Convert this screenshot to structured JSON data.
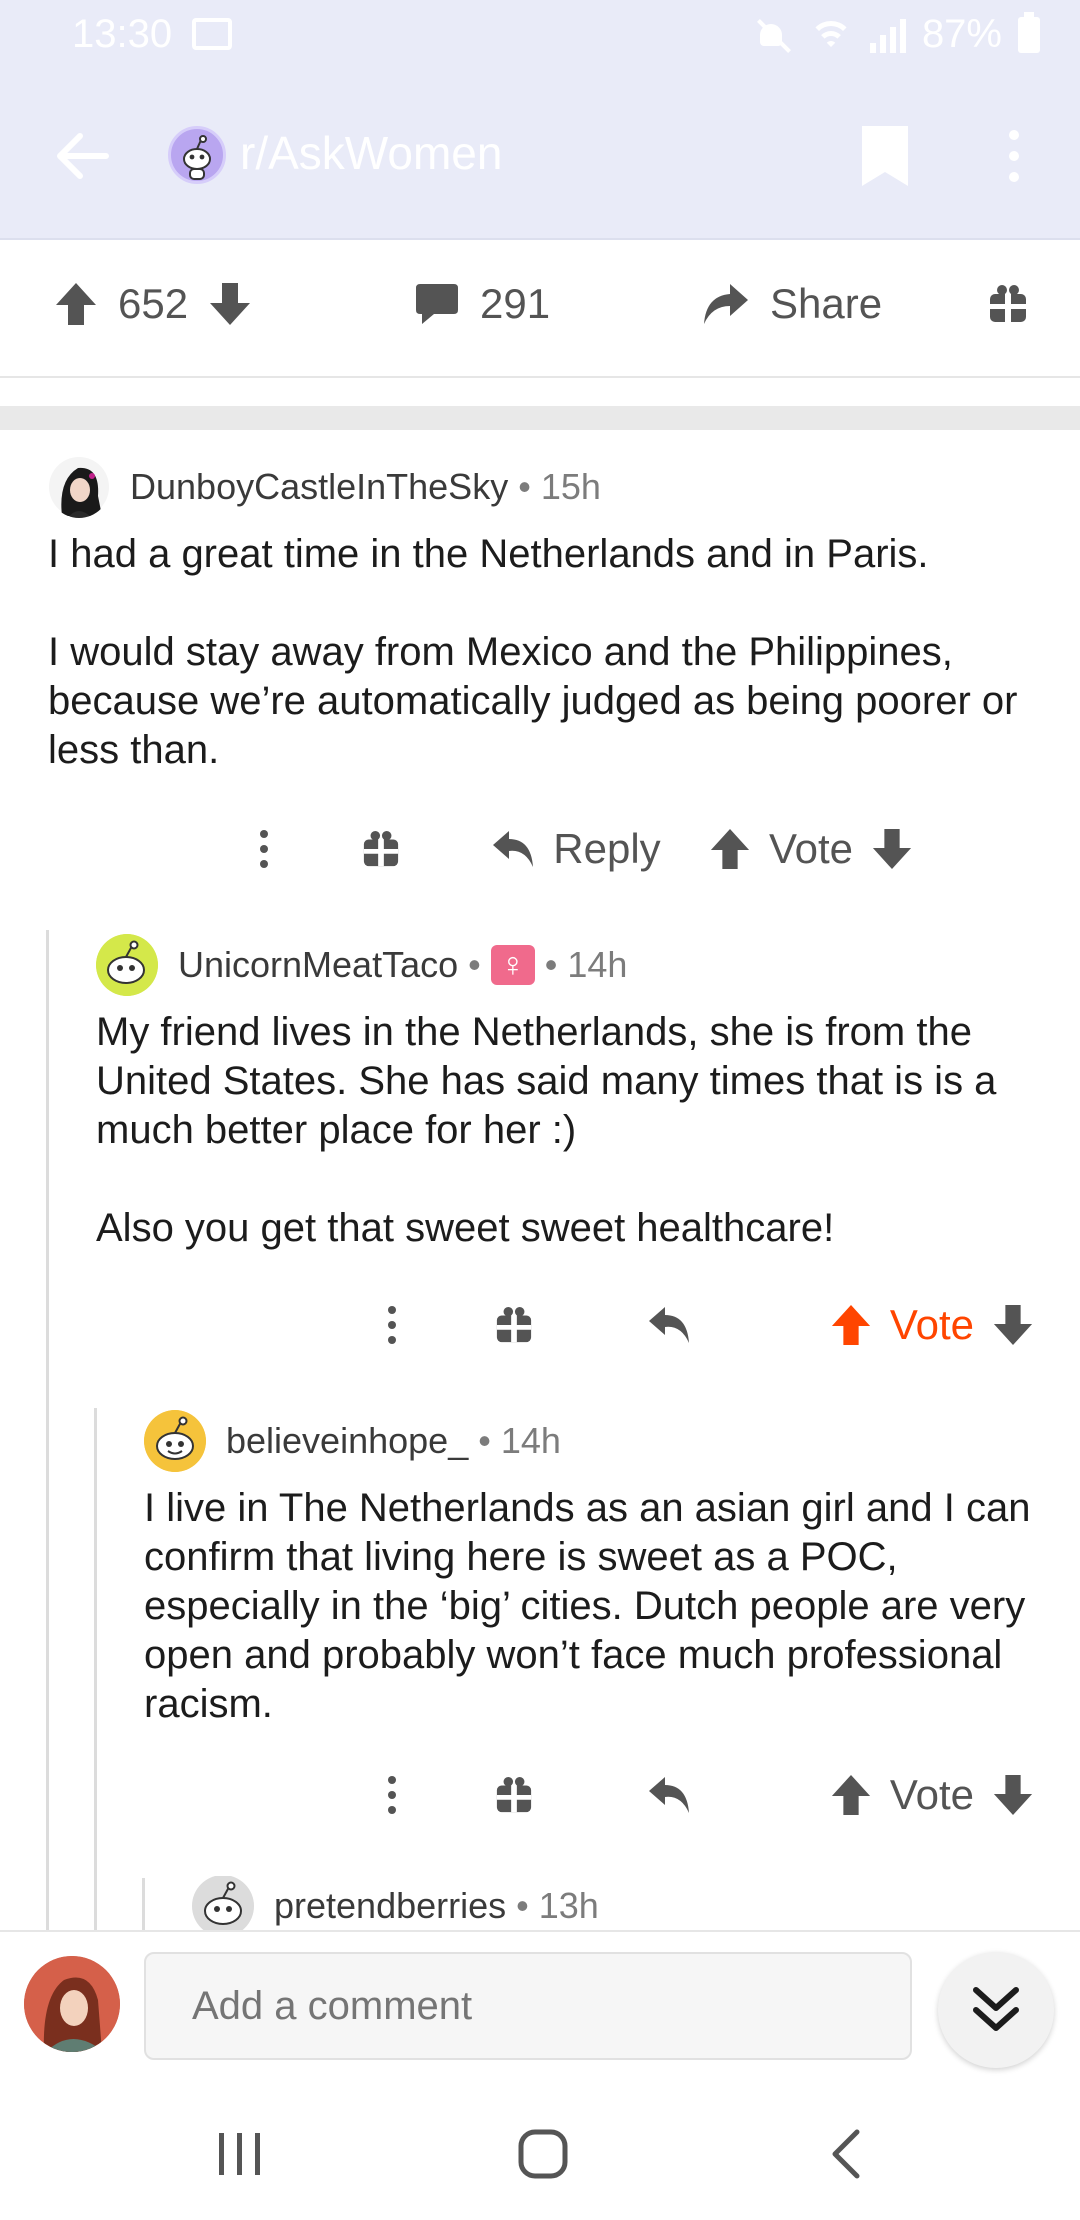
{
  "status_bar": {
    "time": "13:30",
    "battery": "87%"
  },
  "header": {
    "subreddit": "r/AskWomen"
  },
  "post_bar": {
    "upvotes": "652",
    "comments": "291",
    "share_label": "Share"
  },
  "comments": [
    {
      "author": "DunboyCastleInTheSky",
      "age": "15h",
      "paragraphs": [
        "I had a great time in the Netherlands and in Paris.",
        "I would stay away from Mexico and the Philippines, because we’re automatically judged as being poorer or less than."
      ],
      "reply_label": "Reply",
      "vote_label": "Vote"
    },
    {
      "author": "UnicornMeatTaco",
      "flair": "♀",
      "age": "14h",
      "paragraphs": [
        "My friend lives in the Netherlands, she is from the United States. She has said many times that is is a much better place for her :)",
        "Also you get that sweet sweet healthcare!"
      ],
      "vote_label": "Vote",
      "vote_state": "upvoted"
    },
    {
      "author": "believeinhope_",
      "age": "14h",
      "paragraphs": [
        "I live in The Netherlands as an asian girl and I can confirm that living here is sweet as a POC, especially in the ‘big’ cities. Dutch people are very open and probably won’t face much professional racism."
      ],
      "vote_label": "Vote"
    },
    {
      "author": "pretendberries",
      "age": "13h"
    }
  ],
  "composer": {
    "placeholder": "Add a comment"
  },
  "colors": {
    "header_bg": "#e9ebf8",
    "upvote_active": "#ff4500",
    "text_meta": "#7c7c7c"
  }
}
